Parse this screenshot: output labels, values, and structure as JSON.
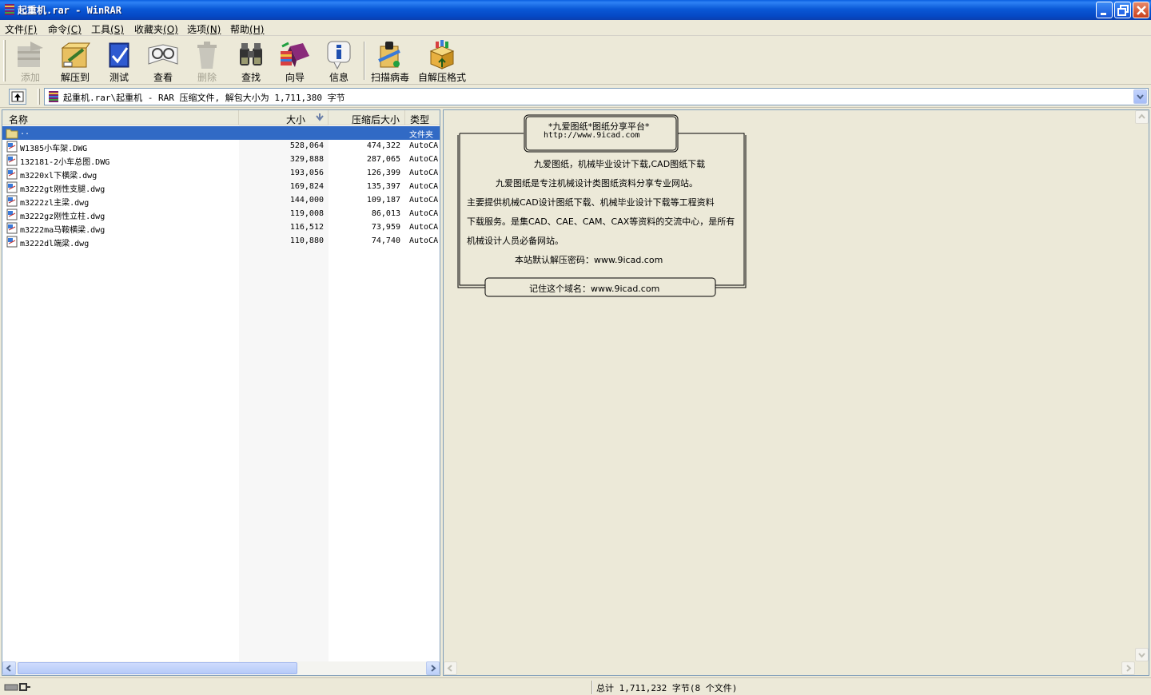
{
  "window": {
    "title": "起重机.rar - WinRAR"
  },
  "menu": [
    {
      "label": "文件",
      "accel": "(F)"
    },
    {
      "label": "命令",
      "accel": "(C)"
    },
    {
      "label": "工具",
      "accel": "(S)"
    },
    {
      "label": "收藏夹",
      "accel": "(O)"
    },
    {
      "label": "选项",
      "accel": "(N)"
    },
    {
      "label": "帮助",
      "accel": "(H)"
    }
  ],
  "toolbar": [
    {
      "label": "添加",
      "icon": "add-icon",
      "enabled": false
    },
    {
      "label": "解压到",
      "icon": "extract-icon",
      "enabled": true
    },
    {
      "label": "测试",
      "icon": "test-icon",
      "enabled": true
    },
    {
      "label": "查看",
      "icon": "view-icon",
      "enabled": true
    },
    {
      "label": "删除",
      "icon": "delete-icon",
      "enabled": false
    },
    {
      "label": "查找",
      "icon": "find-icon",
      "enabled": true
    },
    {
      "label": "向导",
      "icon": "wizard-icon",
      "enabled": true
    },
    {
      "label": "信息",
      "icon": "info-icon",
      "enabled": true
    },
    {
      "label": "扫描病毒",
      "icon": "virus-scan-icon",
      "enabled": true
    },
    {
      "label": "自解压格式",
      "icon": "sfx-icon",
      "enabled": true
    }
  ],
  "address": {
    "text": "起重机.rar\\起重机 - RAR 压缩文件, 解包大小为 1,711,380 字节"
  },
  "list": {
    "columns": {
      "name": "名称",
      "size": "大小",
      "packed": "压缩后大小",
      "type": "类型"
    },
    "parent": {
      "name": "..",
      "type": "文件夹"
    },
    "files": [
      {
        "name": "W1385小车架.DWG",
        "size": "528,064",
        "packed": "474,322",
        "type": "AutoCA"
      },
      {
        "name": "132181-2小车总图.DWG",
        "size": "329,888",
        "packed": "287,065",
        "type": "AutoCA"
      },
      {
        "name": "m3220xl下横梁.dwg",
        "size": "193,056",
        "packed": "126,399",
        "type": "AutoCA"
      },
      {
        "name": "m3222gt刚性支腿.dwg",
        "size": "169,824",
        "packed": "135,397",
        "type": "AutoCA"
      },
      {
        "name": "m3222zl主梁.dwg",
        "size": "144,000",
        "packed": "109,187",
        "type": "AutoCA"
      },
      {
        "name": "m3222gz刚性立柱.dwg",
        "size": "119,008",
        "packed": "86,013",
        "type": "AutoCA"
      },
      {
        "name": "m3222ma马鞍横梁.dwg",
        "size": "116,512",
        "packed": "73,959",
        "type": "AutoCA"
      },
      {
        "name": "m3222dl端梁.dwg",
        "size": "110,880",
        "packed": "74,740",
        "type": "AutoCA"
      }
    ]
  },
  "comment": {
    "header_title": "*九爱图纸*图纸分享平台*",
    "header_url": "http://www.9icad.com",
    "lines": [
      "九爱图纸，机械毕业设计下载,CAD图纸下载",
      "九爱图纸是专注机械设计类图纸资料分享专业网站。",
      "主要提供机械CAD设计图纸下载、机械毕业设计下载等工程资料",
      "下载服务。是集CAD、CAE、CAM、CAX等资料的交流中心，是所有",
      "机械设计人员必备网站。",
      "本站默认解压密码：www.9icad.com"
    ],
    "footer": "记住这个域名：www.9icad.com"
  },
  "status": {
    "text": "总计 1,711,232 字节(8 个文件)"
  }
}
